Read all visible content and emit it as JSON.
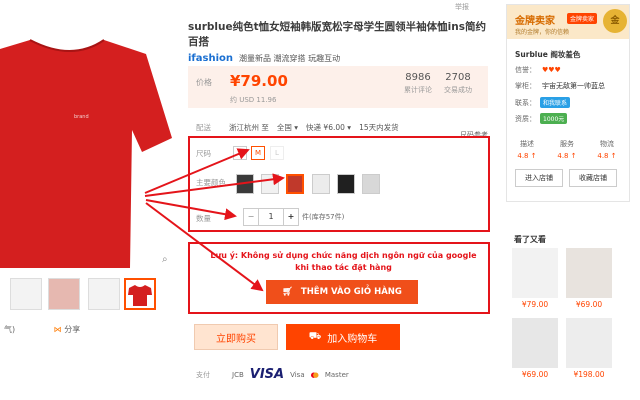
{
  "header": {
    "report": "举报"
  },
  "product": {
    "title": "surblue纯色t恤女短袖韩版宽松字母学生圆领半袖体恤ins简约百搭",
    "brand_logo": "ifashion",
    "brand_tagline": "潮量新品 潮流穿搭 玩趣互动",
    "price_label": "价格",
    "price": "¥79.00",
    "price_usd": "约 USD 11.96",
    "stats": [
      {
        "num": "8986",
        "label": "累计评论"
      },
      {
        "num": "2708",
        "label": "交易成功"
      }
    ]
  },
  "shipping": {
    "label": "配送",
    "from": "浙江杭州 至",
    "to": "全国 ▾",
    "express": "快递 ¥6.00 ▾",
    "delivery": "15天内发货"
  },
  "options": {
    "size_label": "尺码",
    "sizes": [
      "S",
      "M",
      "L"
    ],
    "selected_size": "M",
    "color_label": "主要颜色",
    "swatch_colors": [
      "#3a3a3a",
      "#f1f1f1",
      "#c0392b",
      "#ececec",
      "#202020",
      "#d8d8d8"
    ],
    "qty_label": "数量",
    "qty": "1",
    "qty_minus": "−",
    "qty_plus": "+",
    "stock": "件(库存57件)",
    "partial_link": "尺码参考"
  },
  "notice": {
    "line1": "Lưu ý: Không sử dụng chức năng dịch ngôn ngữ của google",
    "line2": "khi thao tác đặt hàng",
    "cart_button": "THÊM VÀO GIỎ HÀNG"
  },
  "actions": {
    "buy_now": "立即购买",
    "add_cart": "加入购物车"
  },
  "payment": {
    "label": "支付",
    "methods": [
      "JCB",
      "VISA",
      "Visa",
      "Master"
    ]
  },
  "gallery": {
    "main_text": "brand",
    "share": "分享",
    "partial_text": "气)",
    "thumbs": [
      "#f0f0f0",
      "#e6b8b0",
      "#e9e9e9",
      "#d41f1f"
    ],
    "active_thumb": 3
  },
  "shop": {
    "tier": "金牌卖家",
    "tier_badge": "金牌卖家",
    "slogan": "我的金牌，你的信赖",
    "coin": "金",
    "name": "Surblue 阁妆羞色",
    "rows": [
      {
        "label": "信誉：",
        "value": "♥♥♥"
      },
      {
        "label": "掌柜：",
        "value": "宇宙无敌第一帅蓝总"
      },
      {
        "label": "联系：",
        "value": "和我联系"
      },
      {
        "label": "资质：",
        "value": "1000元"
      }
    ],
    "dsr": [
      {
        "label": "描述",
        "score": "4.8 ↑"
      },
      {
        "label": "服务",
        "score": "4.8 ↑"
      },
      {
        "label": "物流",
        "score": "4.8 ↑"
      }
    ],
    "enter_shop": "进入店铺",
    "fav_shop": "收藏店铺"
  },
  "recommend": {
    "title": "看了又看",
    "items": [
      {
        "price": "¥79.00"
      },
      {
        "price": "¥69.00"
      },
      {
        "price": "¥69.00"
      },
      {
        "price": "¥198.00"
      }
    ]
  },
  "colors": {
    "accent": "#ff4400",
    "annotation": "#e4141a",
    "shirt": "#d41f1f"
  }
}
